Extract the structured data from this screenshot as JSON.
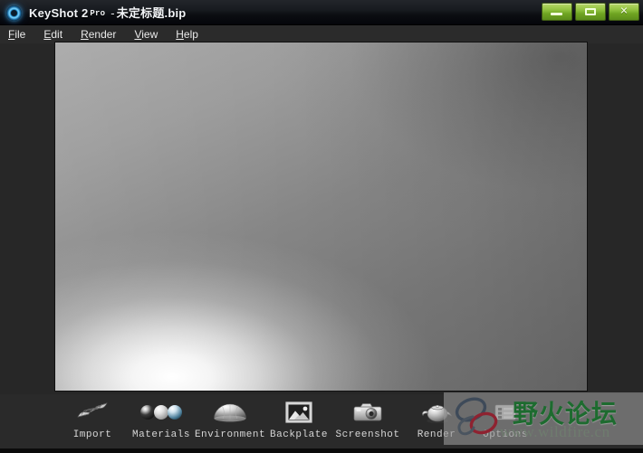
{
  "window": {
    "title_app": "KeyShot 2",
    "title_pro": "Pro",
    "title_dash": "-",
    "title_doc_cjk": "未定标题",
    "title_doc_ext": ".bip",
    "app_icon": "keyshot-orb-icon",
    "controls": {
      "minimize": "minimize-button",
      "maximize": "maximize-button",
      "close_label": "✕"
    },
    "accent_green": "#8fc03d",
    "titlebar_color": "#13161b",
    "chrome_color": "#2a2a2a"
  },
  "menubar": {
    "items": [
      {
        "acc": "F",
        "rest": "ile"
      },
      {
        "acc": "E",
        "rest": "dit"
      },
      {
        "acc": "R",
        "rest": "ender"
      },
      {
        "acc": "V",
        "rest": "iew"
      },
      {
        "acc": "H",
        "rest": "elp"
      }
    ]
  },
  "viewport": {
    "name": "render-viewport",
    "description": "empty gray studio gradient backdrop",
    "gradient_light": "#ffffff",
    "gradient_mid": "#9b9b9b",
    "gradient_dark": "#6a6a6a"
  },
  "toolbar": {
    "items": [
      {
        "label": "Import",
        "icon": "import-mesh-icon"
      },
      {
        "label": "Materials",
        "icon": "material-spheres-icon"
      },
      {
        "label": "Environment",
        "icon": "environment-dome-icon"
      },
      {
        "label": "Backplate",
        "icon": "backplate-image-icon"
      },
      {
        "label": "Screenshot",
        "icon": "camera-icon"
      },
      {
        "label": "Render",
        "icon": "teapot-icon"
      },
      {
        "label": "Options",
        "icon": "options-gear-icon"
      }
    ]
  },
  "watermark": {
    "cjk": "野火论坛",
    "url": "www.wildfire.cn",
    "logo": "butterfly-loops-logo",
    "color_cjk": "#1d6b2f"
  }
}
